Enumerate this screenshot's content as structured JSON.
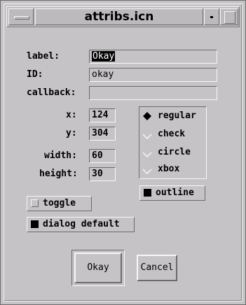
{
  "window": {
    "title": "attribs.icn"
  },
  "fields": {
    "label": {
      "label": "label:",
      "value": "Okay"
    },
    "id": {
      "label": "ID:",
      "value": "okay"
    },
    "callback": {
      "label": "callback:",
      "value": ""
    }
  },
  "geometry": {
    "x": {
      "label": "x:",
      "value": "124"
    },
    "y": {
      "label": "y:",
      "value": "304"
    },
    "width": {
      "label": "width:",
      "value": "60"
    },
    "height": {
      "label": "height:",
      "value": "30"
    }
  },
  "style_options": [
    {
      "label": "regular",
      "selected": true
    },
    {
      "label": "check",
      "selected": false
    },
    {
      "label": "circle",
      "selected": false
    },
    {
      "label": "xbox",
      "selected": false
    }
  ],
  "checkboxes": {
    "outline": {
      "label": "outline",
      "checked": true
    },
    "toggle": {
      "label": "toggle",
      "checked": false
    },
    "dialog_default": {
      "label": "dialog default",
      "checked": true
    }
  },
  "buttons": {
    "okay": "Okay",
    "cancel": "Cancel"
  }
}
